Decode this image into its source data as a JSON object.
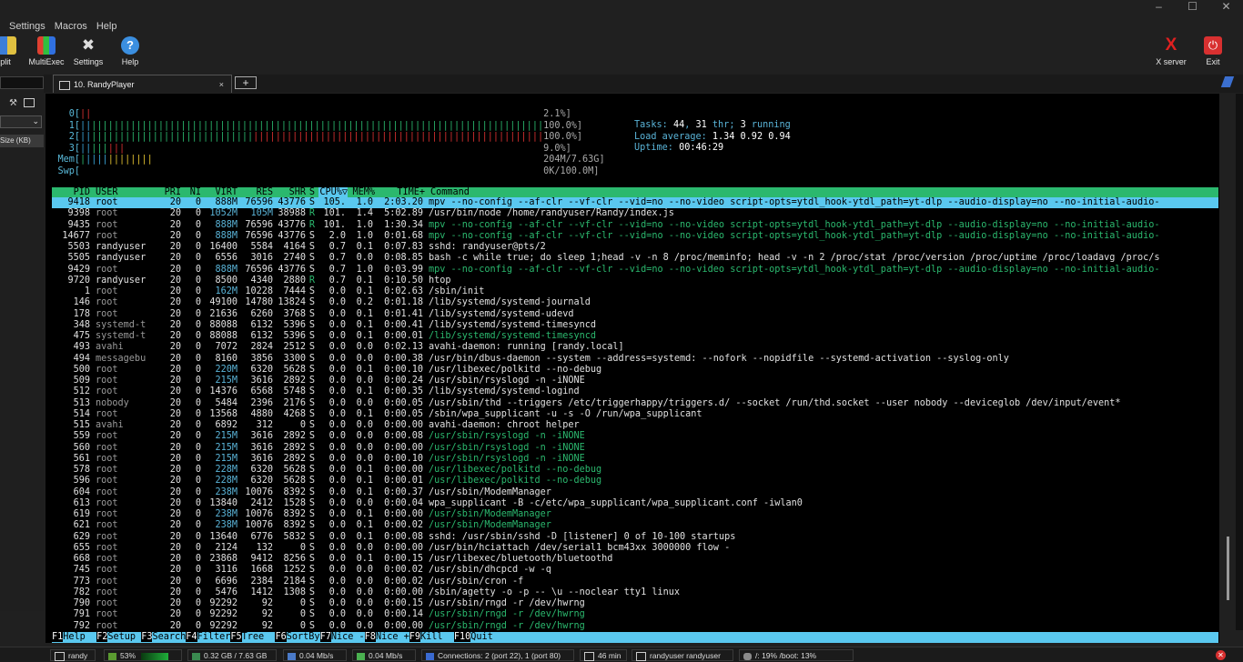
{
  "menu": [
    "Settings",
    "Macros",
    "Help"
  ],
  "toolbar": {
    "split": "Split",
    "multiexec": "MultiExec",
    "settings": "Settings",
    "help": "Help",
    "xserver": "X server",
    "exit": "Exit"
  },
  "tab": {
    "title": "10. RandyPlayer",
    "close": "×",
    "new": "+"
  },
  "side": {
    "size_label": "Size (KB)"
  },
  "meters": {
    "cpu0": {
      "label": "0[",
      "value": "2.1%]"
    },
    "cpu1": {
      "label": "1[",
      "value": "100.0%]"
    },
    "cpu2": {
      "label": "2[",
      "value": "100.0%]"
    },
    "cpu3": {
      "label": "3[",
      "value": "9.0%]"
    },
    "mem": {
      "label": "Mem[",
      "value": "204M/7.63G]"
    },
    "swp": {
      "label": "Swp[",
      "value": "0K/100.0M]"
    }
  },
  "sysinfo": {
    "tasks_label": "Tasks: ",
    "tasks": "44",
    "thr_sep": ", ",
    "thr": "31",
    "thr_label": " thr; ",
    "running": "3",
    "running_label": " running",
    "load_label": "Load average: ",
    "load": "1.34 0.92 0.94",
    "uptime_label": "Uptime: ",
    "uptime": "00:46:29"
  },
  "header": {
    "pid": "PID",
    "user": "USER",
    "pri": "PRI",
    "ni": "NI",
    "virt": "VIRT",
    "res": "RES",
    "shr": "SHR",
    "s": "S",
    "cpu": "CPU%▽",
    "mem": "MEM%",
    "time": "TIME+",
    "cmd": "Command"
  },
  "processes": [
    {
      "pid": "9418",
      "user": "root",
      "pri": "20",
      "ni": "0",
      "virt": "888M",
      "res": "76596",
      "shr": "43776",
      "s": "S",
      "cpu": "105.",
      "mem": "1.0",
      "time": "2:03.20",
      "cmd": "mpv --no-config --af-clr --vf-clr --vid=no --no-video script-opts=ytdl_hook-ytdl_path=yt-dlp --audio-display=no --no-initial-audio-",
      "sel": true
    },
    {
      "pid": "9398",
      "user": "root",
      "pri": "20",
      "ni": "0",
      "virt": "1052M",
      "res": "105M",
      "shr": "38988",
      "s": "R",
      "cpu": "101.",
      "mem": "1.4",
      "time": "5:02.89",
      "cmd": "/usr/bin/node /home/randyuser/Randy/index.js"
    },
    {
      "pid": "9435",
      "user": "root",
      "pri": "20",
      "ni": "0",
      "virt": "888M",
      "res": "76596",
      "shr": "43776",
      "s": "R",
      "cpu": "101.",
      "mem": "1.0",
      "time": "1:30.34",
      "cmd": "mpv --no-config --af-clr --vf-clr --vid=no --no-video script-opts=ytdl_hook-ytdl_path=yt-dlp --audio-display=no --no-initial-audio-",
      "thread": true
    },
    {
      "pid": "14677",
      "user": "root",
      "pri": "20",
      "ni": "0",
      "virt": "888M",
      "res": "76596",
      "shr": "43776",
      "s": "S",
      "cpu": "2.0",
      "mem": "1.0",
      "time": "0:01.68",
      "cmd": "mpv --no-config --af-clr --vf-clr --vid=no --no-video script-opts=ytdl_hook-ytdl_path=yt-dlp --audio-display=no --no-initial-audio-",
      "thread": true
    },
    {
      "pid": "5503",
      "user": "randyuser",
      "pri": "20",
      "ni": "0",
      "virt": "16400",
      "res": "5584",
      "shr": "4164",
      "s": "S",
      "cpu": "0.7",
      "mem": "0.1",
      "time": "0:07.83",
      "cmd": "sshd: randyuser@pts/2"
    },
    {
      "pid": "5505",
      "user": "randyuser",
      "pri": "20",
      "ni": "0",
      "virt": "6556",
      "res": "3016",
      "shr": "2740",
      "s": "S",
      "cpu": "0.7",
      "mem": "0.0",
      "time": "0:08.85",
      "cmd": "bash -c while true; do sleep 1;head -v -n 8 /proc/meminfo; head -v -n 2 /proc/stat /proc/version /proc/uptime /proc/loadavg /proc/s"
    },
    {
      "pid": "9429",
      "user": "root",
      "pri": "20",
      "ni": "0",
      "virt": "888M",
      "res": "76596",
      "shr": "43776",
      "s": "S",
      "cpu": "0.7",
      "mem": "1.0",
      "time": "0:03.99",
      "cmd": "mpv --no-config --af-clr --vf-clr --vid=no --no-video script-opts=ytdl_hook-ytdl_path=yt-dlp --audio-display=no --no-initial-audio-",
      "thread": true
    },
    {
      "pid": "9720",
      "user": "randyuser",
      "pri": "20",
      "ni": "0",
      "virt": "8500",
      "res": "4340",
      "shr": "2880",
      "s": "R",
      "cpu": "0.7",
      "mem": "0.1",
      "time": "0:10.50",
      "cmd": "htop"
    },
    {
      "pid": "1",
      "user": "root",
      "pri": "20",
      "ni": "0",
      "virt": "162M",
      "res": "10228",
      "shr": "7444",
      "s": "S",
      "cpu": "0.0",
      "mem": "0.1",
      "time": "0:02.63",
      "cmd": "/sbin/init"
    },
    {
      "pid": "146",
      "user": "root",
      "pri": "20",
      "ni": "0",
      "virt": "49100",
      "res": "14780",
      "shr": "13824",
      "s": "S",
      "cpu": "0.0",
      "mem": "0.2",
      "time": "0:01.18",
      "cmd": "/lib/systemd/systemd-journald"
    },
    {
      "pid": "178",
      "user": "root",
      "pri": "20",
      "ni": "0",
      "virt": "21636",
      "res": "6260",
      "shr": "3768",
      "s": "S",
      "cpu": "0.0",
      "mem": "0.1",
      "time": "0:01.41",
      "cmd": "/lib/systemd/systemd-udevd"
    },
    {
      "pid": "348",
      "user": "systemd-t",
      "pri": "20",
      "ni": "0",
      "virt": "88088",
      "res": "6132",
      "shr": "5396",
      "s": "S",
      "cpu": "0.0",
      "mem": "0.1",
      "time": "0:00.41",
      "cmd": "/lib/systemd/systemd-timesyncd"
    },
    {
      "pid": "475",
      "user": "systemd-t",
      "pri": "20",
      "ni": "0",
      "virt": "88088",
      "res": "6132",
      "shr": "5396",
      "s": "S",
      "cpu": "0.0",
      "mem": "0.1",
      "time": "0:00.01",
      "cmd": "/lib/systemd/systemd-timesyncd",
      "thread": true
    },
    {
      "pid": "493",
      "user": "avahi",
      "pri": "20",
      "ni": "0",
      "virt": "7072",
      "res": "2824",
      "shr": "2512",
      "s": "S",
      "cpu": "0.0",
      "mem": "0.0",
      "time": "0:02.13",
      "cmd": "avahi-daemon: running [randy.local]"
    },
    {
      "pid": "494",
      "user": "messagebu",
      "pri": "20",
      "ni": "0",
      "virt": "8160",
      "res": "3856",
      "shr": "3300",
      "s": "S",
      "cpu": "0.0",
      "mem": "0.0",
      "time": "0:00.38",
      "cmd": "/usr/bin/dbus-daemon --system --address=systemd: --nofork --nopidfile --systemd-activation --syslog-only"
    },
    {
      "pid": "500",
      "user": "root",
      "pri": "20",
      "ni": "0",
      "virt": "220M",
      "res": "6320",
      "shr": "5628",
      "s": "S",
      "cpu": "0.0",
      "mem": "0.1",
      "time": "0:00.10",
      "cmd": "/usr/libexec/polkitd --no-debug"
    },
    {
      "pid": "509",
      "user": "root",
      "pri": "20",
      "ni": "0",
      "virt": "215M",
      "res": "3616",
      "shr": "2892",
      "s": "S",
      "cpu": "0.0",
      "mem": "0.0",
      "time": "0:00.24",
      "cmd": "/usr/sbin/rsyslogd -n -iNONE"
    },
    {
      "pid": "512",
      "user": "root",
      "pri": "20",
      "ni": "0",
      "virt": "14376",
      "res": "6568",
      "shr": "5748",
      "s": "S",
      "cpu": "0.0",
      "mem": "0.1",
      "time": "0:00.35",
      "cmd": "/lib/systemd/systemd-logind"
    },
    {
      "pid": "513",
      "user": "nobody",
      "pri": "20",
      "ni": "0",
      "virt": "5484",
      "res": "2396",
      "shr": "2176",
      "s": "S",
      "cpu": "0.0",
      "mem": "0.0",
      "time": "0:00.05",
      "cmd": "/usr/sbin/thd --triggers /etc/triggerhappy/triggers.d/ --socket /run/thd.socket --user nobody --deviceglob /dev/input/event*"
    },
    {
      "pid": "514",
      "user": "root",
      "pri": "20",
      "ni": "0",
      "virt": "13568",
      "res": "4880",
      "shr": "4268",
      "s": "S",
      "cpu": "0.0",
      "mem": "0.1",
      "time": "0:00.05",
      "cmd": "/sbin/wpa_supplicant -u -s -O /run/wpa_supplicant"
    },
    {
      "pid": "515",
      "user": "avahi",
      "pri": "20",
      "ni": "0",
      "virt": "6892",
      "res": "312",
      "shr": "0",
      "s": "S",
      "cpu": "0.0",
      "mem": "0.0",
      "time": "0:00.00",
      "cmd": "avahi-daemon: chroot helper"
    },
    {
      "pid": "559",
      "user": "root",
      "pri": "20",
      "ni": "0",
      "virt": "215M",
      "res": "3616",
      "shr": "2892",
      "s": "S",
      "cpu": "0.0",
      "mem": "0.0",
      "time": "0:00.08",
      "cmd": "/usr/sbin/rsyslogd -n -iNONE",
      "thread": true
    },
    {
      "pid": "560",
      "user": "root",
      "pri": "20",
      "ni": "0",
      "virt": "215M",
      "res": "3616",
      "shr": "2892",
      "s": "S",
      "cpu": "0.0",
      "mem": "0.0",
      "time": "0:00.00",
      "cmd": "/usr/sbin/rsyslogd -n -iNONE",
      "thread": true
    },
    {
      "pid": "561",
      "user": "root",
      "pri": "20",
      "ni": "0",
      "virt": "215M",
      "res": "3616",
      "shr": "2892",
      "s": "S",
      "cpu": "0.0",
      "mem": "0.0",
      "time": "0:00.10",
      "cmd": "/usr/sbin/rsyslogd -n -iNONE",
      "thread": true
    },
    {
      "pid": "578",
      "user": "root",
      "pri": "20",
      "ni": "0",
      "virt": "228M",
      "res": "6320",
      "shr": "5628",
      "s": "S",
      "cpu": "0.0",
      "mem": "0.1",
      "time": "0:00.00",
      "cmd": "/usr/libexec/polkitd --no-debug",
      "thread": true
    },
    {
      "pid": "596",
      "user": "root",
      "pri": "20",
      "ni": "0",
      "virt": "228M",
      "res": "6320",
      "shr": "5628",
      "s": "S",
      "cpu": "0.0",
      "mem": "0.1",
      "time": "0:00.01",
      "cmd": "/usr/libexec/polkitd --no-debug",
      "thread": true
    },
    {
      "pid": "604",
      "user": "root",
      "pri": "20",
      "ni": "0",
      "virt": "238M",
      "res": "10076",
      "shr": "8392",
      "s": "S",
      "cpu": "0.0",
      "mem": "0.1",
      "time": "0:00.37",
      "cmd": "/usr/sbin/ModemManager"
    },
    {
      "pid": "613",
      "user": "root",
      "pri": "20",
      "ni": "0",
      "virt": "13840",
      "res": "2412",
      "shr": "1528",
      "s": "S",
      "cpu": "0.0",
      "mem": "0.0",
      "time": "0:00.04",
      "cmd": "wpa_supplicant -B -c/etc/wpa_supplicant/wpa_supplicant.conf -iwlan0"
    },
    {
      "pid": "619",
      "user": "root",
      "pri": "20",
      "ni": "0",
      "virt": "238M",
      "res": "10076",
      "shr": "8392",
      "s": "S",
      "cpu": "0.0",
      "mem": "0.1",
      "time": "0:00.00",
      "cmd": "/usr/sbin/ModemManager",
      "thread": true
    },
    {
      "pid": "621",
      "user": "root",
      "pri": "20",
      "ni": "0",
      "virt": "238M",
      "res": "10076",
      "shr": "8392",
      "s": "S",
      "cpu": "0.0",
      "mem": "0.1",
      "time": "0:00.02",
      "cmd": "/usr/sbin/ModemManager",
      "thread": true
    },
    {
      "pid": "629",
      "user": "root",
      "pri": "20",
      "ni": "0",
      "virt": "13640",
      "res": "6776",
      "shr": "5832",
      "s": "S",
      "cpu": "0.0",
      "mem": "0.1",
      "time": "0:00.08",
      "cmd": "sshd: /usr/sbin/sshd -D [listener] 0 of 10-100 startups"
    },
    {
      "pid": "655",
      "user": "root",
      "pri": "20",
      "ni": "0",
      "virt": "2124",
      "res": "132",
      "shr": "0",
      "s": "S",
      "cpu": "0.0",
      "mem": "0.0",
      "time": "0:00.00",
      "cmd": "/usr/bin/hciattach /dev/serial1 bcm43xx 3000000 flow -"
    },
    {
      "pid": "668",
      "user": "root",
      "pri": "20",
      "ni": "0",
      "virt": "23868",
      "res": "9412",
      "shr": "8256",
      "s": "S",
      "cpu": "0.0",
      "mem": "0.1",
      "time": "0:00.15",
      "cmd": "/usr/libexec/bluetooth/bluetoothd"
    },
    {
      "pid": "745",
      "user": "root",
      "pri": "20",
      "ni": "0",
      "virt": "3116",
      "res": "1668",
      "shr": "1252",
      "s": "S",
      "cpu": "0.0",
      "mem": "0.0",
      "time": "0:00.02",
      "cmd": "/usr/sbin/dhcpcd -w -q"
    },
    {
      "pid": "773",
      "user": "root",
      "pri": "20",
      "ni": "0",
      "virt": "6696",
      "res": "2384",
      "shr": "2184",
      "s": "S",
      "cpu": "0.0",
      "mem": "0.0",
      "time": "0:00.02",
      "cmd": "/usr/sbin/cron -f"
    },
    {
      "pid": "782",
      "user": "root",
      "pri": "20",
      "ni": "0",
      "virt": "5476",
      "res": "1412",
      "shr": "1308",
      "s": "S",
      "cpu": "0.0",
      "mem": "0.0",
      "time": "0:00.00",
      "cmd": "/sbin/agetty -o -p -- \\u --noclear tty1 linux"
    },
    {
      "pid": "790",
      "user": "root",
      "pri": "20",
      "ni": "0",
      "virt": "92292",
      "res": "92",
      "shr": "0",
      "s": "S",
      "cpu": "0.0",
      "mem": "0.0",
      "time": "0:00.15",
      "cmd": "/usr/sbin/rngd -r /dev/hwrng"
    },
    {
      "pid": "791",
      "user": "root",
      "pri": "20",
      "ni": "0",
      "virt": "92292",
      "res": "92",
      "shr": "0",
      "s": "S",
      "cpu": "0.0",
      "mem": "0.0",
      "time": "0:00.14",
      "cmd": "/usr/sbin/rngd -r /dev/hwrng",
      "thread": true
    },
    {
      "pid": "792",
      "user": "root",
      "pri": "20",
      "ni": "0",
      "virt": "92292",
      "res": "92",
      "shr": "0",
      "s": "S",
      "cpu": "0.0",
      "mem": "0.0",
      "time": "0:00.00",
      "cmd": "/usr/sbin/rngd -r /dev/hwrng",
      "thread": true
    }
  ],
  "fkeys": [
    {
      "k": "F1",
      "l": "Help  "
    },
    {
      "k": "F2",
      "l": "Setup "
    },
    {
      "k": "F3",
      "l": "Search"
    },
    {
      "k": "F4",
      "l": "Filter"
    },
    {
      "k": "F5",
      "l": "Tree  "
    },
    {
      "k": "F6",
      "l": "SortBy"
    },
    {
      "k": "F7",
      "l": "Nice -"
    },
    {
      "k": "F8",
      "l": "Nice +"
    },
    {
      "k": "F9",
      "l": "Kill  "
    },
    {
      "k": "F10",
      "l": "Quit  "
    }
  ],
  "statusbar": {
    "user": "randy",
    "cpu": "53%",
    "mem": "0.32 GB / 7.63 GB",
    "up": "0.04 Mb/s",
    "down": "0.04 Mb/s",
    "connections": "Connections: 2 (port 22), 1 (port 80)",
    "time": "46 min",
    "session": "randyuser  randyuser",
    "disk": "/: 19%  /boot: 13%"
  },
  "colors": {
    "selection": "#5ac8ef",
    "header": "#2bb86e",
    "meter_label": "#59b9d9"
  }
}
